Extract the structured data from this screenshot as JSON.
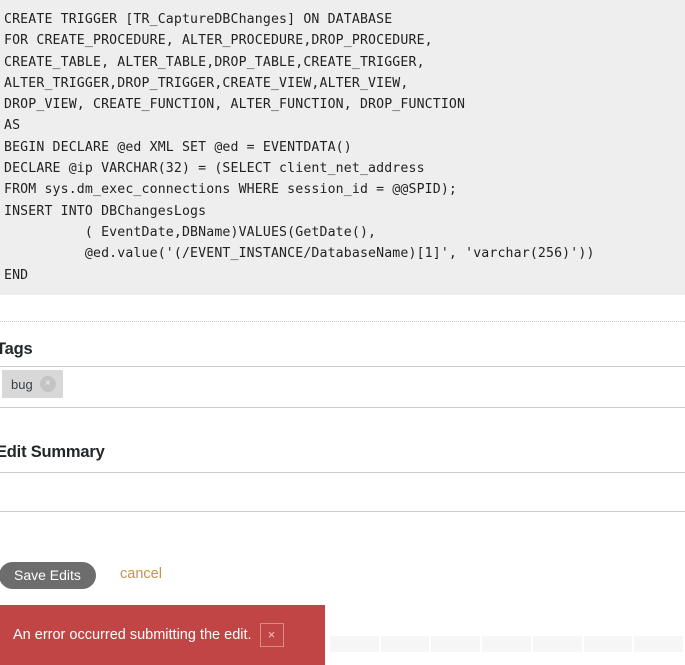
{
  "code_block": {
    "language": "sql",
    "content": "CREATE TRIGGER [TR_CaptureDBChanges] ON DATABASE\nFOR CREATE_PROCEDURE, ALTER_PROCEDURE,DROP_PROCEDURE,\nCREATE_TABLE, ALTER_TABLE,DROP_TABLE,CREATE_TRIGGER,\nALTER_TRIGGER,DROP_TRIGGER,CREATE_VIEW,ALTER_VIEW,\nDROP_VIEW, CREATE_FUNCTION, ALTER_FUNCTION, DROP_FUNCTION\nAS\nBEGIN DECLARE @ed XML SET @ed = EVENTDATA()\nDECLARE @ip VARCHAR(32) = (SELECT client_net_address\nFROM sys.dm_exec_connections WHERE session_id = @@SPID);\nINSERT INTO DBChangesLogs\n          ( EventDate,DBName)VALUES(GetDate(),\n          @ed.value('(/EVENT_INSTANCE/DatabaseName)[1]', 'varchar(256)'))\nEND",
    "background_color": "#eeeeee"
  },
  "tags_section": {
    "label": "Tags",
    "tags": [
      {
        "name": "bug",
        "remove_icon": "close-icon",
        "remove_glyph": "×"
      }
    ]
  },
  "edit_summary_section": {
    "label": "Edit Summary",
    "value": "",
    "placeholder": ""
  },
  "actions": {
    "save_label": "Save Edits",
    "save_color": "#6d6d6d",
    "cancel_label": "cancel",
    "cancel_color": "#c8924a"
  },
  "error_banner": {
    "message": "An error occurred submitting the edit.",
    "close_icon": "close-icon",
    "close_glyph": "×",
    "background_color": "#c14545"
  },
  "bottom_grid": {
    "cell_count": 7,
    "cell_color": "#f6f6f6"
  }
}
